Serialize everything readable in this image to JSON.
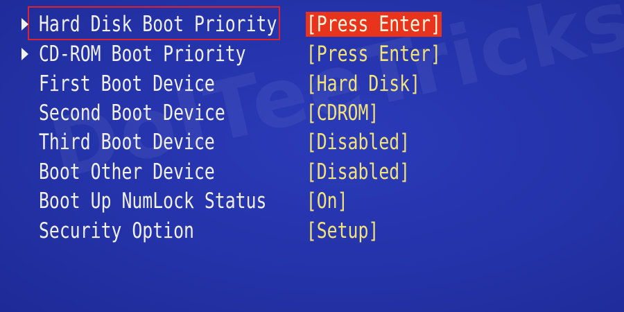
{
  "bios": {
    "items": [
      {
        "label": "Hard Disk Boot Priority",
        "value": "[Press Enter]",
        "submenu": true,
        "selected": true
      },
      {
        "label": "CD-ROM Boot Priority",
        "value": "[Press Enter]",
        "submenu": true,
        "selected": false
      },
      {
        "label": "First Boot Device",
        "value": "[Hard Disk]",
        "submenu": false,
        "selected": false
      },
      {
        "label": "Second Boot Device",
        "value": "[CDROM]",
        "submenu": false,
        "selected": false
      },
      {
        "label": "Third Boot Device",
        "value": "[Disabled]",
        "submenu": false,
        "selected": false
      },
      {
        "label": "Boot Other Device",
        "value": "[Disabled]",
        "submenu": false,
        "selected": false
      },
      {
        "label": "Boot Up NumLock Status",
        "value": "[On]",
        "submenu": false,
        "selected": false
      },
      {
        "label": "Security Option",
        "value": "[Setup]",
        "submenu": false,
        "selected": false
      }
    ]
  },
  "watermark": {
    "text": "DoITeeTricks"
  },
  "colors": {
    "background": "#2433a9",
    "label": "#f0f0e8",
    "value": "#f2e27a",
    "selected_bg": "#e8341c",
    "annotation_box": "#e0222a"
  }
}
